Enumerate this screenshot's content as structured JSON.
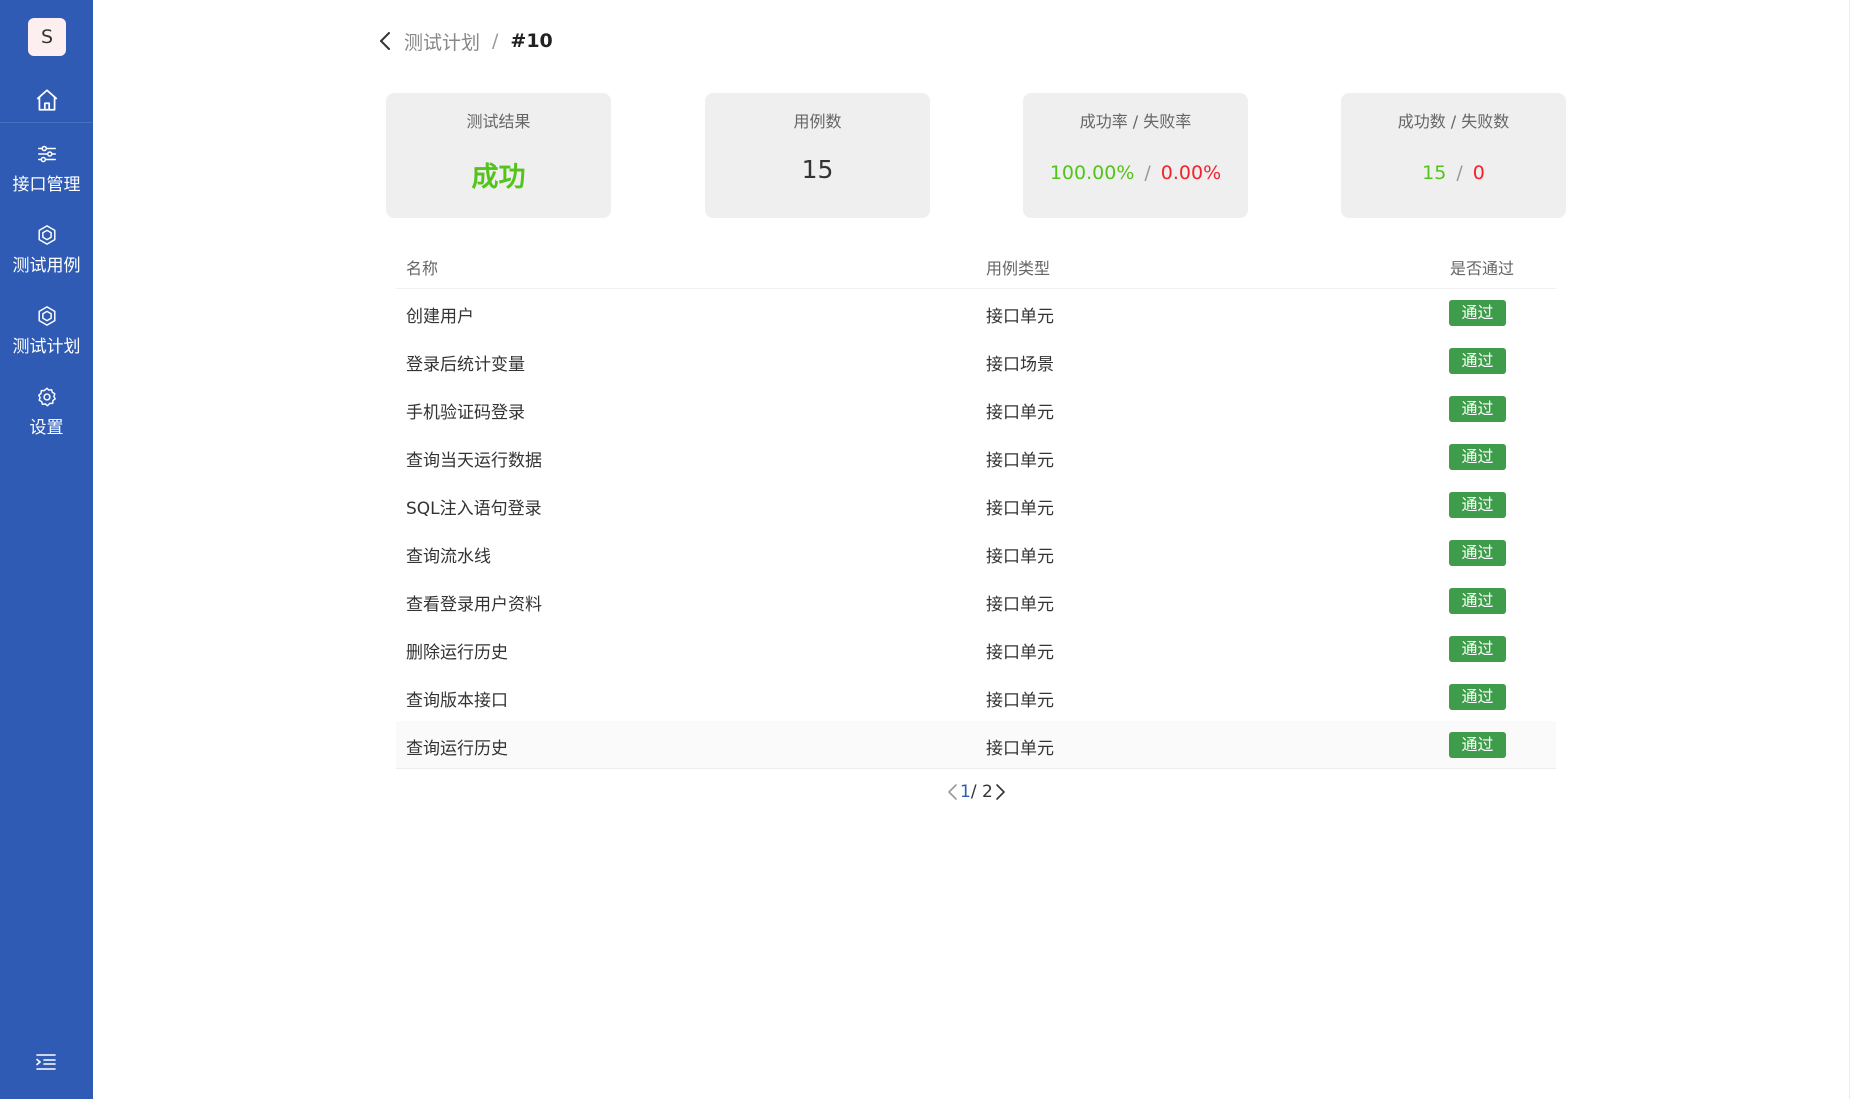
{
  "app": {
    "logo_letter": "S"
  },
  "sidebar": {
    "items": [
      {
        "label": "接口管理",
        "icon": "sliders-icon"
      },
      {
        "label": "测试用例",
        "icon": "cube-icon"
      },
      {
        "label": "测试计划",
        "icon": "cube-icon"
      },
      {
        "label": "设置",
        "icon": "gear-icon"
      }
    ]
  },
  "breadcrumb": {
    "parent": "测试计划",
    "separator": "/",
    "current": "#10"
  },
  "stats": {
    "result": {
      "label": "测试结果",
      "value": "成功"
    },
    "cases": {
      "label": "用例数",
      "value": "15"
    },
    "rate": {
      "label": "成功率 / 失败率",
      "success": "100.00%",
      "fail": "0.00%",
      "separator": "/"
    },
    "count": {
      "label": "成功数 / 失败数",
      "success": "15",
      "fail": "0",
      "separator": "/"
    }
  },
  "table": {
    "headers": {
      "name": "名称",
      "type": "用例类型",
      "pass": "是否通过"
    },
    "rows": [
      {
        "name": "创建用户",
        "type": "接口单元",
        "pass": "通过"
      },
      {
        "name": "登录后统计变量",
        "type": "接口场景",
        "pass": "通过"
      },
      {
        "name": "手机验证码登录",
        "type": "接口单元",
        "pass": "通过"
      },
      {
        "name": "查询当天运行数据",
        "type": "接口单元",
        "pass": "通过"
      },
      {
        "name": "SQL注入语句登录",
        "type": "接口单元",
        "pass": "通过"
      },
      {
        "name": "查询流水线",
        "type": "接口单元",
        "pass": "通过"
      },
      {
        "name": "查看登录用户资料",
        "type": "接口单元",
        "pass": "通过"
      },
      {
        "name": "删除运行历史",
        "type": "接口单元",
        "pass": "通过"
      },
      {
        "name": "查询版本接口",
        "type": "接口单元",
        "pass": "通过"
      },
      {
        "name": "查询运行历史",
        "type": "接口单元",
        "pass": "通过"
      }
    ]
  },
  "pagination": {
    "current": "1",
    "total": "/ 2"
  },
  "colors": {
    "sidebar": "#2f5bb5",
    "success": "#52c41a",
    "fail": "#f5222d",
    "badge": "#3f9c4a"
  }
}
